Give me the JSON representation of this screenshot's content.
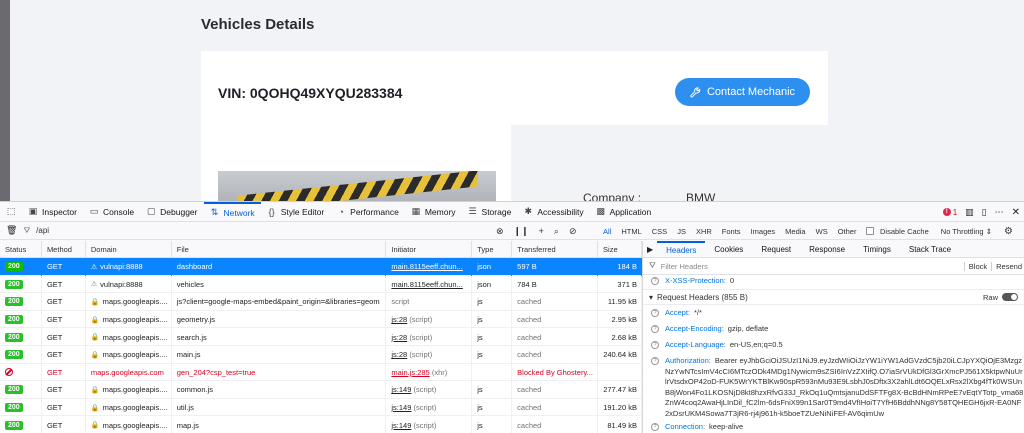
{
  "page": {
    "title": "Vehicles Details",
    "vin": "VIN: 0QOHQ49XYQU283384",
    "contact_button": "Contact Mechanic",
    "company_label": "Company :",
    "company_value": "BMW"
  },
  "devtools": {
    "tools": [
      {
        "label": "Inspector",
        "icon": "inspector-icon"
      },
      {
        "label": "Console",
        "icon": "console-icon"
      },
      {
        "label": "Debugger",
        "icon": "debugger-icon"
      },
      {
        "label": "Network",
        "icon": "network-icon",
        "active": true
      },
      {
        "label": "Style Editor",
        "icon": "style-editor-icon"
      },
      {
        "label": "Performance",
        "icon": "performance-icon"
      },
      {
        "label": "Memory",
        "icon": "memory-icon"
      },
      {
        "label": "Storage",
        "icon": "storage-icon"
      },
      {
        "label": "Accessibility",
        "icon": "accessibility-icon"
      },
      {
        "label": "Application",
        "icon": "application-icon"
      }
    ],
    "error_count": "1",
    "filter_value": "/api",
    "type_filters": [
      "All",
      "HTML",
      "CSS",
      "JS",
      "XHR",
      "Fonts",
      "Images",
      "Media",
      "WS",
      "Other"
    ],
    "disable_cache": "Disable Cache",
    "throttling": "No Throttling"
  },
  "table": {
    "headers": [
      "Status",
      "Method",
      "Domain",
      "File",
      "Initiator",
      "Type",
      "Transferred",
      "Size"
    ],
    "rows": [
      {
        "status": "200",
        "method": "GET",
        "domain": "vulnapi:8888",
        "file": "dashboard",
        "initiator": "main.8115eeff.chun...",
        "type": "json",
        "transferred": "597 B",
        "size": "184 B",
        "selected": true
      },
      {
        "status": "200",
        "method": "GET",
        "domain": "vulnapi:8888",
        "file": "vehicles",
        "initiator": "main.8115eeff.chun...",
        "type": "json",
        "transferred": "784 B",
        "size": "371 B"
      },
      {
        "status": "200",
        "method": "GET",
        "domain": "maps.googleapis....",
        "file": "js?client=google-maps-embed&paint_origin=&libraries=geom",
        "initiator": "script",
        "type": "js",
        "transferred": "cached",
        "size": "11.95 kB"
      },
      {
        "status": "200",
        "method": "GET",
        "domain": "maps.googleapis....",
        "file": "geometry.js",
        "initiator": "js:28",
        "initiator_type": "(script)",
        "type": "js",
        "transferred": "cached",
        "size": "2.95 kB"
      },
      {
        "status": "200",
        "method": "GET",
        "domain": "maps.googleapis....",
        "file": "search.js",
        "initiator": "js:28",
        "initiator_type": "(script)",
        "type": "js",
        "transferred": "cached",
        "size": "2.68 kB"
      },
      {
        "status": "200",
        "method": "GET",
        "domain": "maps.googleapis....",
        "file": "main.js",
        "initiator": "js:28",
        "initiator_type": "(script)",
        "type": "js",
        "transferred": "cached",
        "size": "240.64 kB"
      },
      {
        "status": "",
        "method": "GET",
        "domain": "maps.googleapis.com",
        "file": "gen_204?csp_test=true",
        "initiator": "main.js:285",
        "initiator_type": "(xhr)",
        "type": "",
        "transferred": "Blocked By Ghostery...",
        "size": "",
        "blocked": true
      },
      {
        "status": "200",
        "method": "GET",
        "domain": "maps.googleapis....",
        "file": "common.js",
        "initiator": "js:149",
        "initiator_type": "(script)",
        "type": "js",
        "transferred": "cached",
        "size": "277.47 kB"
      },
      {
        "status": "200",
        "method": "GET",
        "domain": "maps.googleapis....",
        "file": "util.js",
        "initiator": "js:149",
        "initiator_type": "(script)",
        "type": "js",
        "transferred": "cached",
        "size": "191.20 kB"
      },
      {
        "status": "200",
        "method": "GET",
        "domain": "maps.googleapis....",
        "file": "map.js",
        "initiator": "js:149",
        "initiator_type": "(script)",
        "type": "js",
        "transferred": "cached",
        "size": "81.49 kB"
      }
    ]
  },
  "details": {
    "tabs": [
      "Headers",
      "Cookies",
      "Request",
      "Response",
      "Timings",
      "Stack Trace"
    ],
    "filter_placeholder": "Filter Headers",
    "block_label": "Block",
    "resend_label": "Resend",
    "xss_line": {
      "name": "X-XSS-Protection:",
      "value": "0"
    },
    "request_headers_title": "Request Headers (855 B)",
    "raw_label": "Raw",
    "headers": [
      {
        "name": "Accept:",
        "value": "*/*"
      },
      {
        "name": "Accept-Encoding:",
        "value": "gzip, deflate"
      },
      {
        "name": "Accept-Language:",
        "value": "en-US,en;q=0.5"
      },
      {
        "name": "Authorization:",
        "value": "Bearer eyJhbGciOiJSUzI1NiJ9.eyJzdWIiOiJzYW1iYW1AdGVzdC5jb20iLCJpYXQiOjE3MzgzNzYwNTcsImV4cCI6MTczODk4MDg1Nywicm9sZSI6InVzZXIifQ.O7iaSrVUkDfGl3GrXmcPJ561X5ktpwNuUrlrVtsdxOP42oD-FUK5WrYKTBlKw90spR593nMu93E9LsbhJ0sDftx3X2ahlLdt6OQELxRsx2lXbg4fTk0WSUnB8jWon4Fo1LKOSNjD8kt8hzxRfvG33J_RkOq1uQmtsjanuDdSFTFg8X-BcBdHNmRPeE7vEqtYTotp_vma68ZnW4coq2AwaHjLInDil_fC2lm-6dsFniX99n1Sar0T9md4VfIHoiT7YfH6BddhNNg8Y58TQHEGH6jxR-EA0NF2xDsrUKM4Sowa7T3jR6-rj4j961h-k5boeTZUeNiNiFEf-AV6qimUw"
      },
      {
        "name": "Connection:",
        "value": "keep-alive"
      }
    ]
  }
}
